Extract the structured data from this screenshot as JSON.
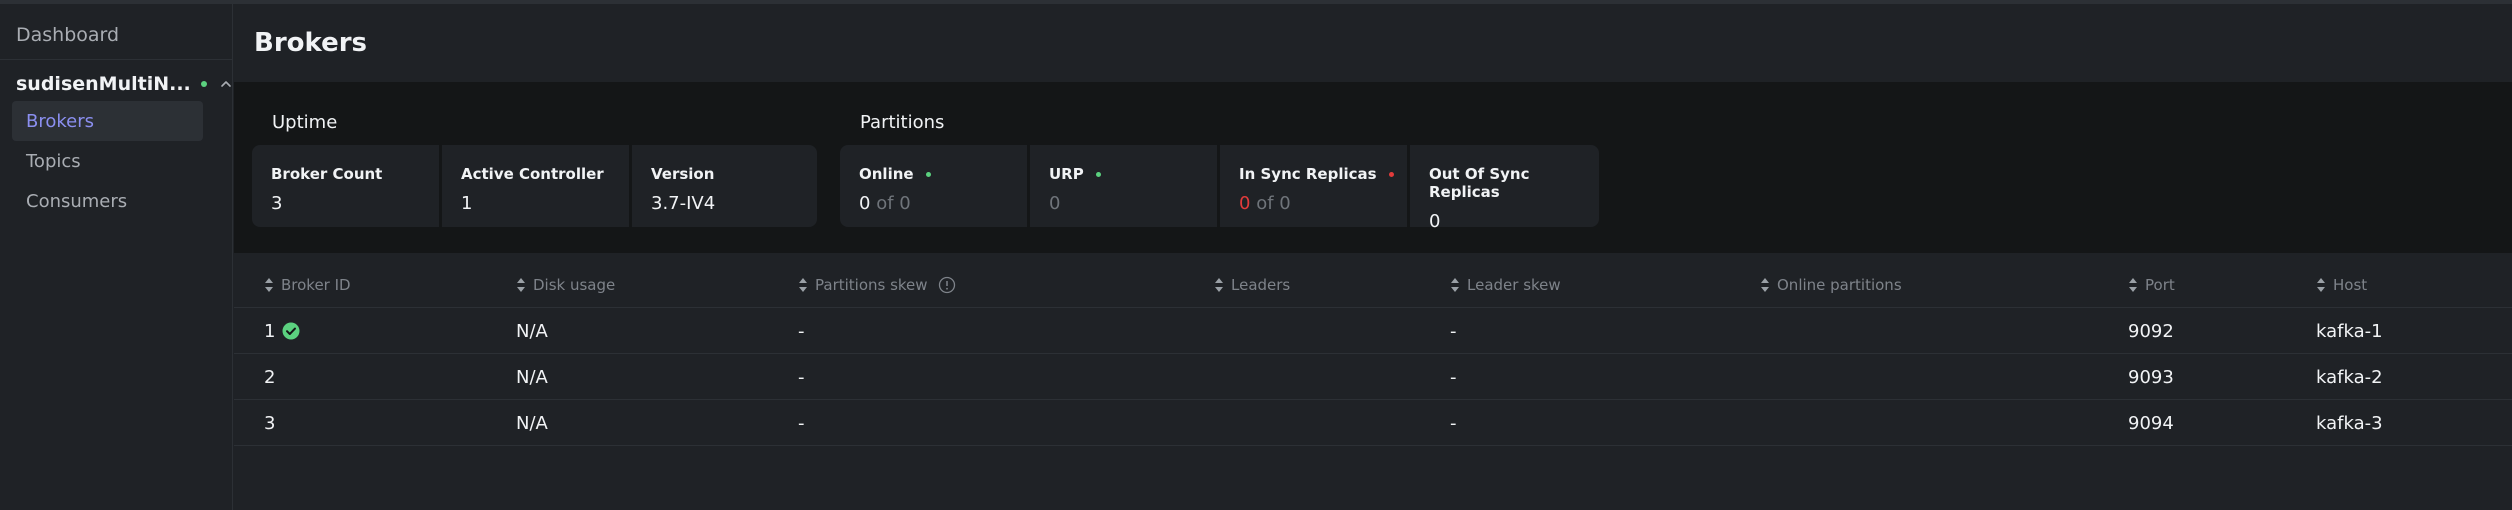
{
  "sidebar": {
    "dashboard_label": "Dashboard",
    "cluster_name": "sudisenMultiN...",
    "cluster_status_color": "#5bd17f",
    "items": [
      {
        "label": "Brokers",
        "active": true
      },
      {
        "label": "Topics",
        "active": false
      },
      {
        "label": "Consumers",
        "active": false
      }
    ]
  },
  "page": {
    "title": "Brokers"
  },
  "uptime": {
    "title": "Uptime",
    "cards": [
      {
        "label": "Broker Count",
        "value": "3"
      },
      {
        "label": "Active Controller",
        "value": "1"
      },
      {
        "label": "Version",
        "value": "3.7-IV4"
      }
    ]
  },
  "partitions": {
    "title": "Partitions",
    "cards": [
      {
        "label": "Online",
        "value": "0",
        "of_text": "of 0",
        "status_color": "#5bd17f"
      },
      {
        "label": "URP",
        "value": "0",
        "status_color": "#5bd17f"
      },
      {
        "label": "In Sync Replicas",
        "value": "0",
        "of_text": "of 0",
        "status_color": "#e23b3b"
      },
      {
        "label": "Out Of Sync Replicas",
        "value": "0"
      }
    ]
  },
  "table": {
    "columns": [
      "Broker ID",
      "Disk usage",
      "Partitions skew",
      "Leaders",
      "Leader skew",
      "Online partitions",
      "Port",
      "Host"
    ],
    "rows": [
      {
        "broker_id": "1",
        "controller": true,
        "disk_usage": "N/A",
        "partitions_skew": "-",
        "leaders": "",
        "leader_skew": "-",
        "online_partitions": "",
        "port": "9092",
        "host": "kafka-1"
      },
      {
        "broker_id": "2",
        "controller": false,
        "disk_usage": "N/A",
        "partitions_skew": "-",
        "leaders": "",
        "leader_skew": "-",
        "online_partitions": "",
        "port": "9093",
        "host": "kafka-2"
      },
      {
        "broker_id": "3",
        "controller": false,
        "disk_usage": "N/A",
        "partitions_skew": "-",
        "leaders": "",
        "leader_skew": "-",
        "online_partitions": "",
        "port": "9094",
        "host": "kafka-3"
      }
    ]
  },
  "icons": {
    "sort": "sort-icon",
    "info": "info-icon",
    "check": "check-circle-icon",
    "chevron": "chevron-up-icon"
  }
}
